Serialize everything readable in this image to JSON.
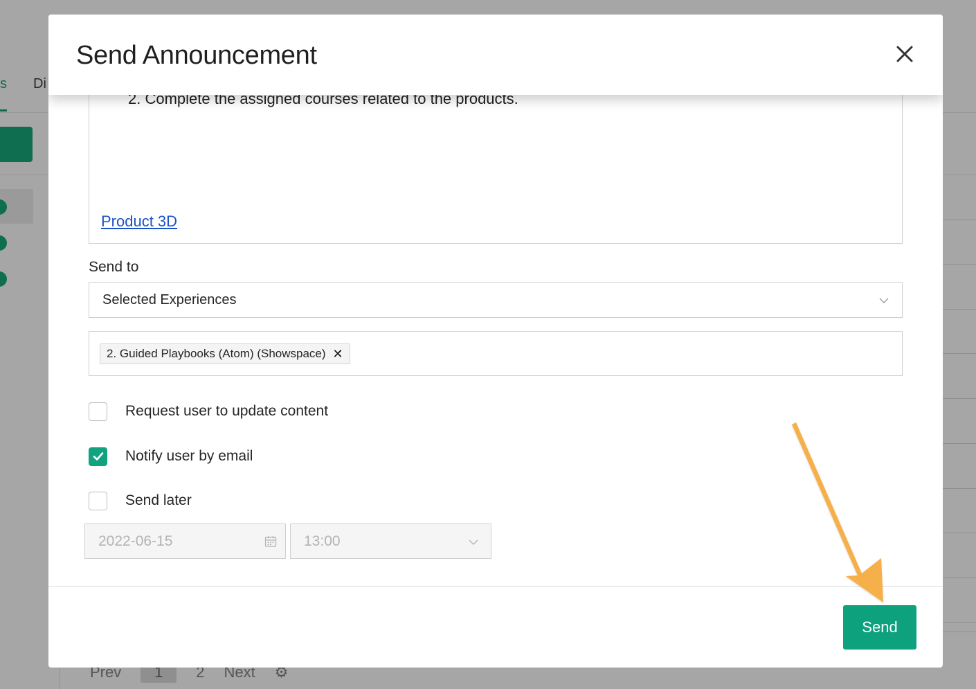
{
  "background": {
    "tab_active_partial": "s",
    "tab_second_partial": "Di",
    "pagination": {
      "prev_partial": "Prev",
      "current_page": "1",
      "page_2": "2",
      "next_partial": "Next"
    }
  },
  "modal": {
    "title": "Send Announcement",
    "editor": {
      "visible_line": "2. Complete the assigned courses related to the products.",
      "link_text": "Product 3D"
    },
    "send_to": {
      "label": "Send to",
      "selected_value": "Selected Experiences",
      "tags": [
        {
          "label": "2. Guided Playbooks (Atom) (Showspace)"
        }
      ]
    },
    "options": [
      {
        "label": "Request user to update content",
        "checked": false
      },
      {
        "label": "Notify user by email",
        "checked": true
      },
      {
        "label": "Send later",
        "checked": false
      }
    ],
    "schedule": {
      "date_value": "2022-06-15",
      "time_value": "13:00"
    },
    "footer": {
      "send_label": "Send"
    }
  },
  "colors": {
    "accent_green": "#0ea17e",
    "link_blue": "#1a52c9",
    "annotation_arrow": "#f5b04a",
    "overlay_gray": "#a6a6a6"
  },
  "icons": {
    "close": "close-icon",
    "dropdown": "chevron-down-icon",
    "calendar": "calendar-icon",
    "tag_remove": "x-icon",
    "check": "checkmark-icon",
    "settings": "gear-icon"
  }
}
